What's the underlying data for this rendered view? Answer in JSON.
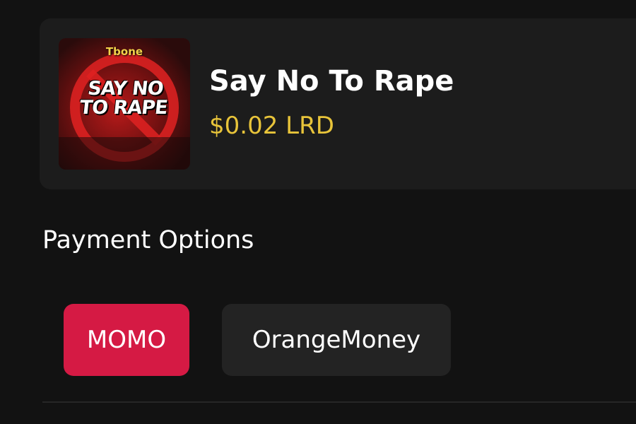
{
  "product": {
    "cover": {
      "artist_text": "Tbone",
      "title_line1": "SAY NO",
      "title_line2": "TO RAPE"
    },
    "title": "Say No To Rape",
    "price": "$0.02 LRD"
  },
  "payment": {
    "section_title": "Payment Options",
    "options": [
      {
        "label": "MOMO",
        "selected": true
      },
      {
        "label": "OrangeMoney",
        "selected": false
      }
    ]
  },
  "colors": {
    "background": "#121212",
    "card": "#1c1c1c",
    "price": "#e8c43a",
    "selected_option": "#d51a44",
    "unselected_option": "#232323"
  }
}
